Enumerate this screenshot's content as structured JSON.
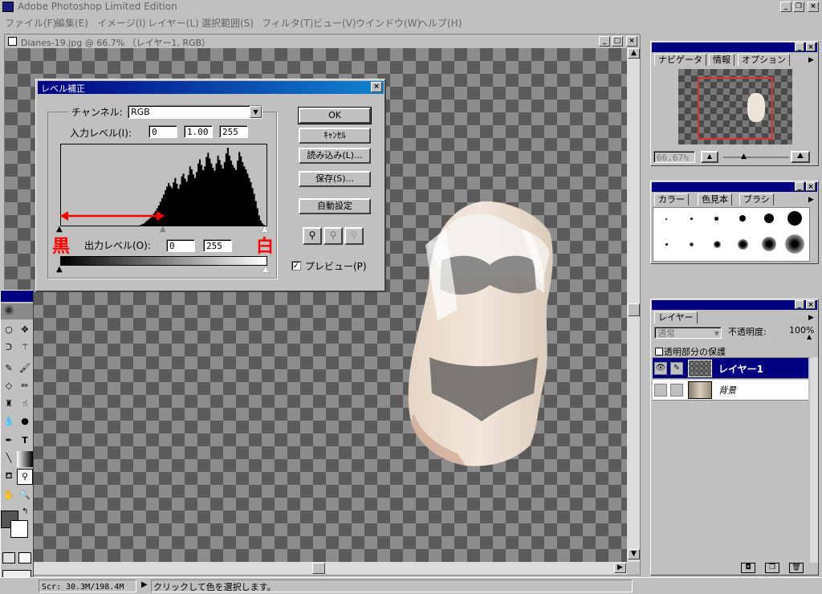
{
  "app": {
    "title": "Adobe Photoshop Limited Edition"
  },
  "menu": [
    "ファイル(F)",
    "編集(E)",
    "イメージ(I)",
    "レイヤー(L)",
    "選択範囲(S)",
    "フィルタ(T)",
    "ビュー(V)",
    "ウインドウ(W)",
    "ヘルプ(H)"
  ],
  "document": {
    "title": "Dianes-19.jpg @ 66.7% （レイヤー1, RGB）"
  },
  "levels_dialog": {
    "title": "レベル補正",
    "channel_label": "チャンネル:",
    "channel_value": "RGB",
    "input_label": "入力レベル(I):",
    "input_black": "0",
    "input_gamma": "1.00",
    "input_white": "255",
    "output_label": "出力レベル(O):",
    "output_black": "0",
    "output_white": "255",
    "annotation_black": "黒",
    "annotation_white": "白",
    "buttons": {
      "ok": "OK",
      "cancel": "ｷｬﾝｾﾙ",
      "load": "読み込み(L)...",
      "save": "保存(S)...",
      "auto": "自動設定"
    },
    "preview_label": "プレビュー(P)",
    "preview_checked": "✓",
    "histogram": [
      0,
      0,
      0,
      0,
      0,
      0,
      0,
      0,
      0,
      0,
      0,
      0,
      0,
      0,
      0,
      0,
      0,
      0,
      0,
      0,
      0,
      0,
      0,
      0,
      0,
      0,
      0,
      0,
      0,
      0,
      0,
      0,
      0,
      0,
      0,
      0,
      0,
      0,
      0,
      0,
      0,
      0,
      0,
      0,
      0,
      0,
      0,
      0,
      1,
      2,
      3,
      5,
      7,
      9,
      11,
      14,
      17,
      20,
      24,
      28,
      33,
      38,
      43,
      49,
      54,
      59,
      55,
      52,
      60,
      66,
      58,
      51,
      57,
      68,
      72,
      65,
      61,
      70,
      82,
      78,
      71,
      66,
      74,
      86,
      92,
      84,
      77,
      82,
      95,
      101,
      93,
      86,
      80,
      76,
      86,
      97,
      91,
      84,
      79,
      88,
      100,
      108,
      97,
      90,
      84,
      80,
      77,
      90,
      102,
      96,
      88,
      82,
      78,
      72,
      66,
      60,
      52,
      44,
      34,
      24,
      14,
      7,
      3,
      1,
      0
    ]
  },
  "navigator": {
    "tabs": [
      "ナビゲータ",
      "情報",
      "オプション"
    ],
    "zoom": "66.67%"
  },
  "brushes": {
    "tabs": [
      "カラー",
      "色見本",
      "ブラシ"
    ]
  },
  "layers": {
    "tab": "レイヤー",
    "blend_mode": "通常",
    "opacity_label": "不透明度:",
    "opacity_value": "100%",
    "preserve_label": "透明部分の保護",
    "items": [
      {
        "name": "レイヤー1"
      },
      {
        "name": "背景"
      }
    ]
  },
  "status": {
    "scratch": "Scr: 30.3M/198.4M",
    "message": "クリックして色を選択します。"
  }
}
